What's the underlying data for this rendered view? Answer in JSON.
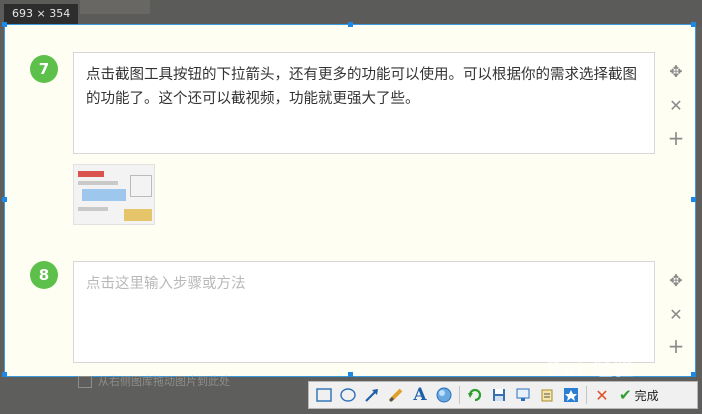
{
  "size_badge": "693 × 354",
  "steps": [
    {
      "number": "7",
      "text": "点击截图工具按钮的下拉箭头，还有更多的功能可以使用。可以根据你的需求选择截图的功能了。这个还可以截视频，功能就更强大了些。"
    },
    {
      "number": "8",
      "placeholder": "点击这里输入步骤或方法"
    }
  ],
  "side_icons": [
    "move-icon",
    "close-icon",
    "add-icon"
  ],
  "drag_hint": "从右侧图库拖动图片到此处",
  "toolbar": {
    "icons": [
      "rectangle-icon",
      "ellipse-icon",
      "arrow-icon",
      "brush-icon",
      "text-icon",
      "color-icon",
      "undo-icon",
      "save-icon",
      "copy-to-screen-icon",
      "pin-icon",
      "upload-icon",
      "cancel-icon"
    ],
    "done_label": "完成"
  },
  "watermark": "Bai 经验"
}
